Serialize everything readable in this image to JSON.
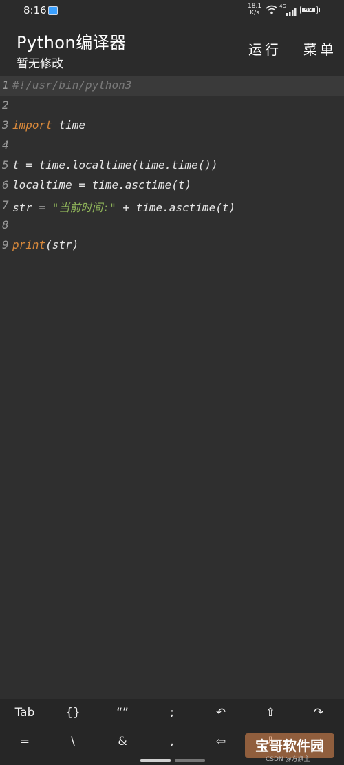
{
  "status_bar": {
    "time": "8:16",
    "net_speed": "18.1",
    "net_unit": "K/s",
    "network": "4G",
    "battery": "49"
  },
  "app_bar": {
    "title": "Python编译器",
    "subtitle": "暂无修改",
    "run_label": "运行",
    "menu_label": "菜单"
  },
  "editor": {
    "lines": [
      {
        "num": "1",
        "text": "#!/usr/bin/python3"
      },
      {
        "num": "2",
        "text": ""
      },
      {
        "num": "3",
        "kw": "import",
        "rest": " time"
      },
      {
        "num": "4",
        "text": ""
      },
      {
        "num": "5",
        "text": "t = time.localtime(time.time())"
      },
      {
        "num": "6",
        "text": "localtime = time.asctime(t)"
      },
      {
        "num": "7",
        "pre": "str = ",
        "str": "\"当前时间:\"",
        "post": " + time.asctime(t)"
      },
      {
        "num": "8",
        "text": ""
      },
      {
        "num": "9",
        "kw": "print",
        "rest": "(str)"
      }
    ]
  },
  "keybar": {
    "row1": [
      "Tab",
      "{}",
      "“”",
      ";",
      "↶",
      "⇧",
      "↷"
    ],
    "row2": [
      "=",
      "\\",
      "&",
      ",",
      "⇦",
      "⇩",
      "⇨"
    ]
  },
  "watermark": {
    "text": "宝哥软件园",
    "sub": "CSDN @方旗主"
  },
  "colors": {
    "background": "#2b2b2b",
    "keyword": "#d9893b",
    "string": "#8fb45a",
    "comment": "#7a7a7a"
  }
}
